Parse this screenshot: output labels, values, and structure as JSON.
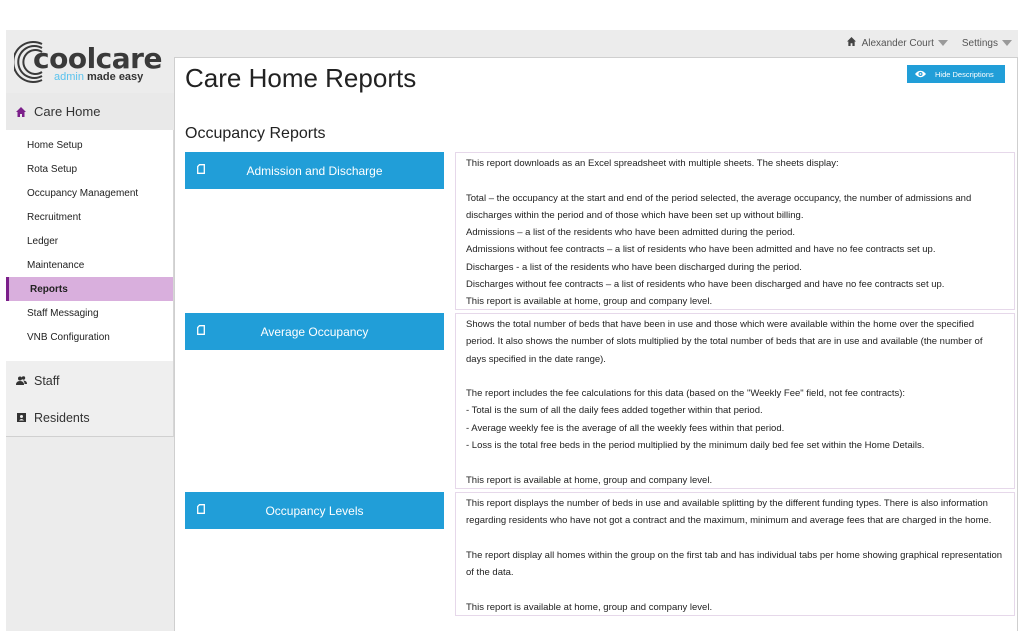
{
  "brand": {
    "name": "coolcare",
    "tagline_accent": "admin",
    "tagline_rest": " made easy",
    "accent_color": "#5ac3ee"
  },
  "topbar": {
    "home_name": "Alexander Court",
    "settings_label": "Settings"
  },
  "sidebar": {
    "care_home_label": "Care Home",
    "items": [
      {
        "label": "Home Setup"
      },
      {
        "label": "Rota Setup"
      },
      {
        "label": "Occupancy Management"
      },
      {
        "label": "Recruitment"
      },
      {
        "label": "Ledger"
      },
      {
        "label": "Maintenance"
      },
      {
        "label": "Reports",
        "active": true
      },
      {
        "label": "Staff Messaging"
      },
      {
        "label": "VNB Configuration"
      }
    ],
    "staff_label": "Staff",
    "residents_label": "Residents",
    "active_color": "#d9afdd",
    "active_border_color": "#7b1f8a"
  },
  "main": {
    "title": "Care Home Reports",
    "hide_descriptions_label": "Hide Descriptions",
    "section_title": "Occupancy Reports",
    "button_color": "#219ed8",
    "reports": [
      {
        "name": "Admission and Discharge",
        "description": [
          "This report downloads as an Excel spreadsheet with multiple sheets. The sheets display:",
          "",
          "Total – the occupancy at the start and end of the period selected, the average occupancy, the number of admissions and discharges within the period and of those which have been set up without billing.",
          "Admissions – a list of the residents who have been admitted during the period.",
          "Admissions without fee contracts – a list of residents who have been admitted and have no fee contracts set up.",
          "Discharges - a list of the residents who have been discharged during the period.",
          "Discharges without fee contracts – a list of residents who have been discharged and have no fee contracts set up.",
          "This report is available at home, group and company level."
        ]
      },
      {
        "name": "Average Occupancy",
        "description": [
          "Shows the total number of beds that have been in use and those which were available within the home over the specified period. It also shows the number of slots multiplied by the total number of beds that are in use and available (the number of days specified in the date range).",
          "",
          "The report includes the fee calculations for this data (based on the \"Weekly Fee\" field, not fee contracts):",
          "- Total is the sum of all the daily fees added together within that period.",
          "- Average weekly fee is the average of all the weekly fees within that period.",
          "- Loss is the total free beds in the period multiplied by the minimum daily bed fee set within the Home Details.",
          "",
          "This report is available at home, group and company level."
        ]
      },
      {
        "name": "Occupancy Levels",
        "description": [
          "This report displays the number of beds in use and available splitting by the different funding types. There is also information regarding residents who have not got a contract and the maximum, minimum and average fees that are charged in the home.",
          "",
          "The report display all homes within the group on the first tab and has individual tabs per home showing graphical representation of the data.",
          "",
          "This report is available at home, group and company level."
        ]
      }
    ]
  }
}
